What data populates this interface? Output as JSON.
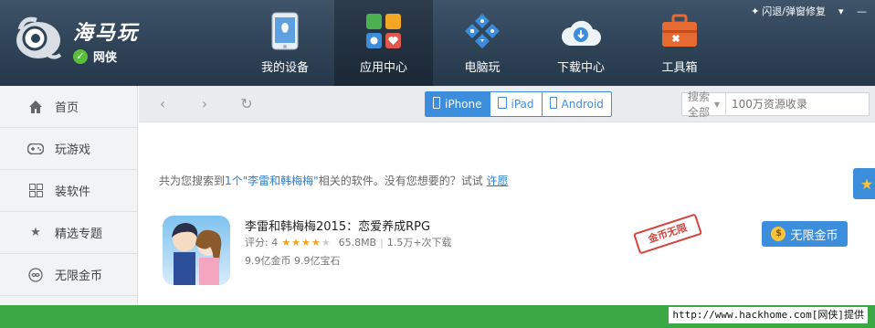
{
  "app": {
    "brand": "海马玩",
    "network_label": "网侠",
    "top_right_action": "闪退/弹窗修复"
  },
  "nav": {
    "items": [
      {
        "label": "我的设备",
        "icon": "phone-icon"
      },
      {
        "label": "应用中心",
        "icon": "apps-grid-icon"
      },
      {
        "label": "电脑玩",
        "icon": "gamepad-icon"
      },
      {
        "label": "下载中心",
        "icon": "cloud-download-icon"
      },
      {
        "label": "工具箱",
        "icon": "toolbox-icon"
      }
    ],
    "active_index": 1
  },
  "sidebar": {
    "items": [
      {
        "label": "首页",
        "icon": "home-icon"
      },
      {
        "label": "玩游戏",
        "icon": "gamepad-icon"
      },
      {
        "label": "装软件",
        "icon": "grid-icon"
      },
      {
        "label": "精选专题",
        "icon": "star-icon"
      },
      {
        "label": "无限金币",
        "icon": "infinity-icon"
      }
    ]
  },
  "toolbar": {
    "device_tabs": [
      {
        "label": "iPhone"
      },
      {
        "label": "iPad"
      },
      {
        "label": "Android"
      }
    ],
    "active_device_index": 0,
    "search_scope": "搜索全部",
    "search_placeholder": "100万资源收录"
  },
  "results": {
    "prefix": "共为您搜索到",
    "count_text": "1个",
    "query_text": "\"李雷和韩梅梅\"",
    "suffix": "相关的软件。没有您想要的？试试",
    "wish_link": "许愿"
  },
  "app_item": {
    "title": "李雷和韩梅梅2015：恋爱养成RPG",
    "rating_label": "评分: 4",
    "rating": 4,
    "rating_max": 5,
    "size": "65.8MB",
    "downloads": "1.5万+次下载",
    "coins": "9.9亿金币 9.9亿宝石",
    "stamp_text": "金币无限",
    "action_label": "无限金币"
  },
  "footer": {
    "watermark": "http://www.hackhome.com[网侠]提供"
  },
  "colors": {
    "header_bg": "#2f4357",
    "accent_blue": "#3c8ddb",
    "footer_green": "#3aa845",
    "star_gold": "#f2a21c",
    "stamp_red": "#d0302b"
  }
}
